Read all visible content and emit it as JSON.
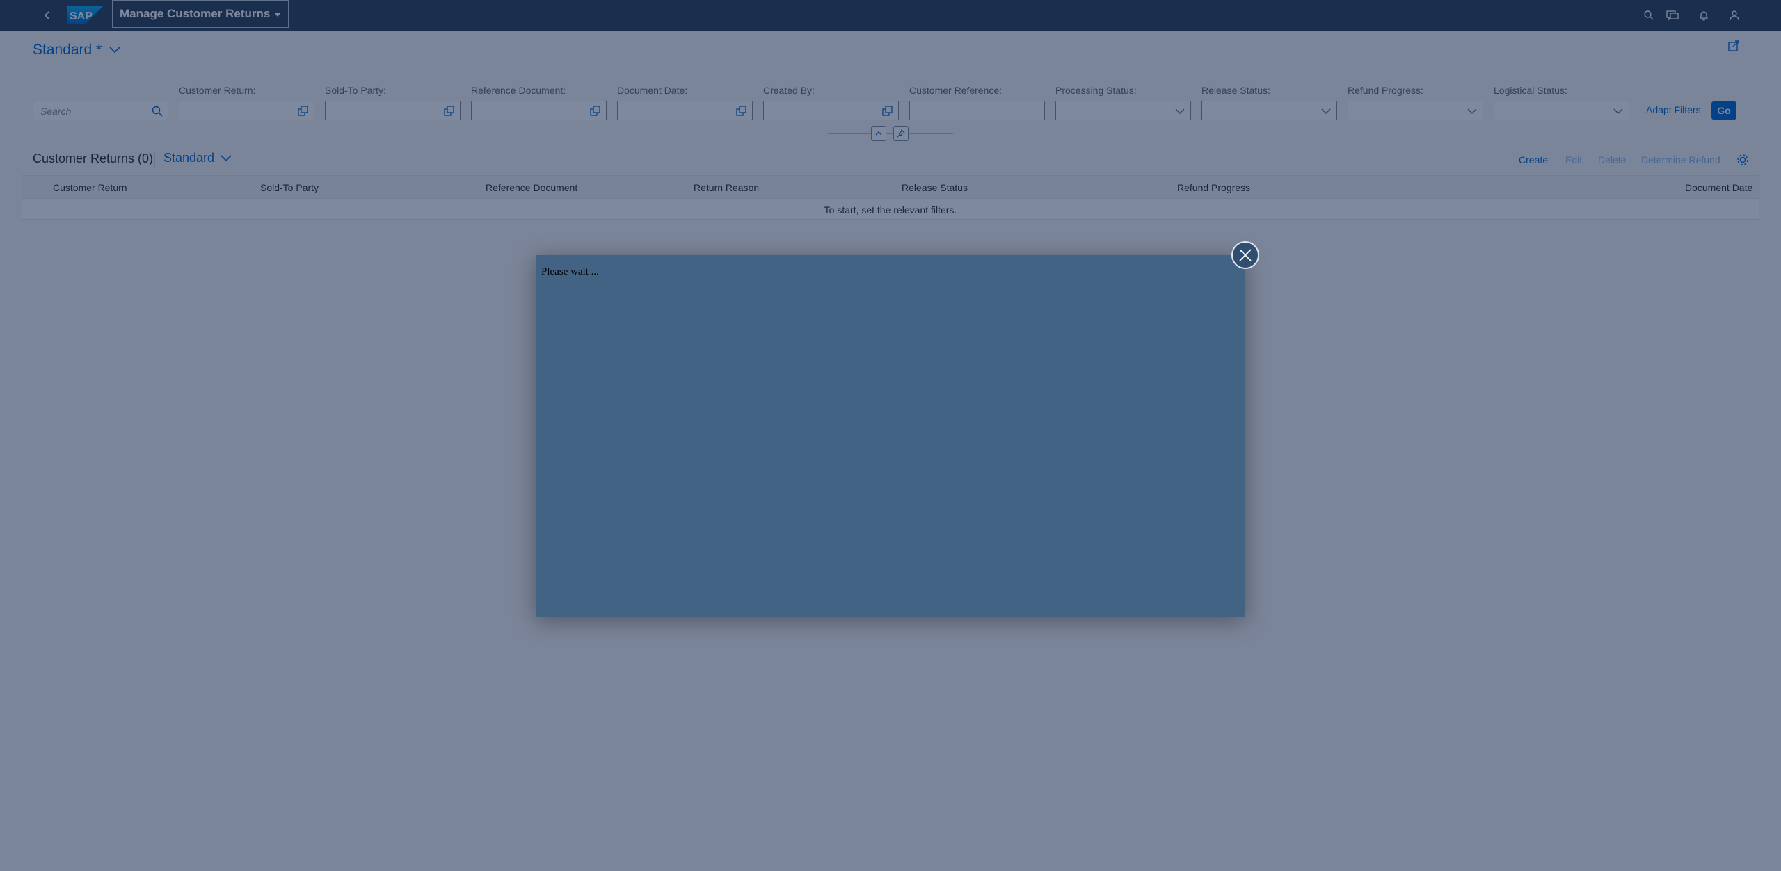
{
  "shell": {
    "app_title": "Manage Customer Returns",
    "icons": [
      "back-icon",
      "sap-logo",
      "search-icon",
      "feedback-icon",
      "notifications-icon",
      "user-icon"
    ]
  },
  "variant": {
    "title": "Standard *"
  },
  "filters": {
    "search_placeholder": "Search",
    "labels": [
      "Customer Return:",
      "Sold-To Party:",
      "Reference Document:",
      "Document Date:",
      "Created By:",
      "Customer Reference:",
      "Processing Status:",
      "Release Status:",
      "Refund Progress:",
      "Logistical Status:"
    ],
    "adapt_label": "Adapt Filters",
    "go_label": "Go"
  },
  "table": {
    "title": "Customer Returns (0)",
    "variant": "Standard",
    "toolbar": {
      "create": "Create",
      "edit": "Edit",
      "delete": "Delete",
      "determine_refund": "Determine Refund"
    },
    "columns": [
      "Customer Return",
      "Sold-To Party",
      "Reference Document",
      "Return Reason",
      "Release Status",
      "Refund Progress",
      "Document Date"
    ],
    "no_data": "To start, set the relevant filters."
  },
  "dialog": {
    "text": "Please wait ..."
  },
  "colors": {
    "shell": "#354a5f",
    "accent": "#0a6ed1",
    "dialog": "#436385"
  }
}
